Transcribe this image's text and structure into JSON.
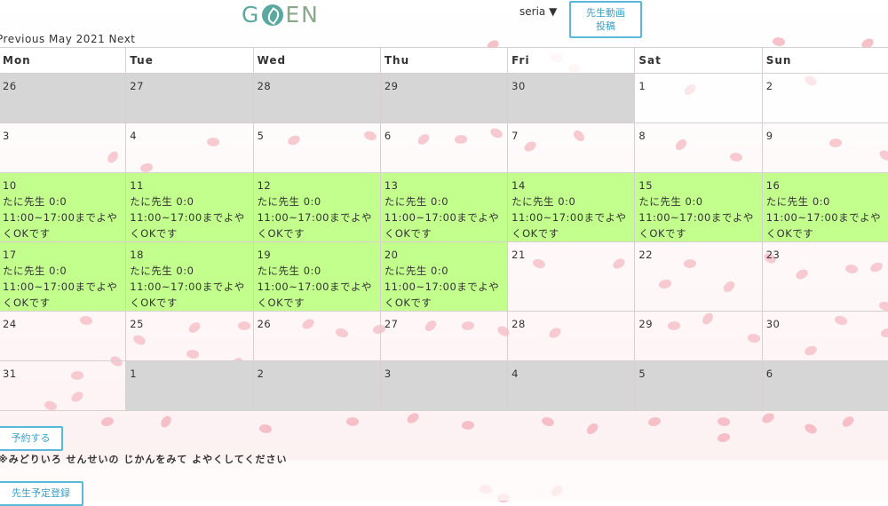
{
  "header": {
    "logo_text": "GOEN",
    "user_menu": "seria ▼",
    "upload_button": [
      "先生動画",
      "投稿"
    ]
  },
  "nav": {
    "previous": "Previous",
    "month_title": "May 2021",
    "next": "Next"
  },
  "weekdays": [
    "Mon",
    "Tue",
    "Wed",
    "Thu",
    "Fri",
    "Sat",
    "Sun"
  ],
  "weeks": [
    [
      {
        "day": "26",
        "state": "gray"
      },
      {
        "day": "27",
        "state": "gray"
      },
      {
        "day": "28",
        "state": "gray"
      },
      {
        "day": "29",
        "state": "gray"
      },
      {
        "day": "30",
        "state": "gray"
      },
      {
        "day": "1",
        "state": "plainw"
      },
      {
        "day": "2",
        "state": "plainw"
      }
    ],
    [
      {
        "day": "3",
        "state": "plain"
      },
      {
        "day": "4",
        "state": "plain"
      },
      {
        "day": "5",
        "state": "plain"
      },
      {
        "day": "6",
        "state": "plain"
      },
      {
        "day": "7",
        "state": "plain"
      },
      {
        "day": "8",
        "state": "plain"
      },
      {
        "day": "9",
        "state": "plain"
      }
    ],
    [
      {
        "day": "10",
        "state": "green",
        "teacher": "たに先生 0:0",
        "note": "11:00~17:00までよやくOKです"
      },
      {
        "day": "11",
        "state": "green",
        "teacher": "たに先生 0:0",
        "note": "11:00~17:00までよやくOKです"
      },
      {
        "day": "12",
        "state": "green",
        "teacher": "たに先生 0:0",
        "note": "11:00~17:00までよやくOKです"
      },
      {
        "day": "13",
        "state": "green",
        "teacher": "たに先生 0:0",
        "note": "11:00~17:00までよやくOKです"
      },
      {
        "day": "14",
        "state": "green",
        "teacher": "たに先生 0:0",
        "note": "11:00~17:00までよやくOKです"
      },
      {
        "day": "15",
        "state": "green",
        "teacher": "たに先生 0:0",
        "note": "11:00~17:00までよやくOKです"
      },
      {
        "day": "16",
        "state": "green",
        "teacher": "たに先生 0:0",
        "note": "11:00~17:00までよやくOKです"
      }
    ],
    [
      {
        "day": "17",
        "state": "green",
        "teacher": "たに先生 0:0",
        "note": "11:00~17:00までよやくOKです"
      },
      {
        "day": "18",
        "state": "green",
        "teacher": "たに先生 0:0",
        "note": "11:00~17:00までよやくOKです"
      },
      {
        "day": "19",
        "state": "green",
        "teacher": "たに先生 0:0",
        "note": "11:00~17:00までよやくOKです"
      },
      {
        "day": "20",
        "state": "green",
        "teacher": "たに先生 0:0",
        "note": "11:00~17:00までよやくOKです"
      },
      {
        "day": "21",
        "state": "plain"
      },
      {
        "day": "22",
        "state": "plain"
      },
      {
        "day": "23",
        "state": "plain"
      }
    ],
    [
      {
        "day": "24",
        "state": "plain"
      },
      {
        "day": "25",
        "state": "plain"
      },
      {
        "day": "26",
        "state": "plain"
      },
      {
        "day": "27",
        "state": "plain"
      },
      {
        "day": "28",
        "state": "plain"
      },
      {
        "day": "29",
        "state": "plain"
      },
      {
        "day": "30",
        "state": "plain"
      }
    ],
    [
      {
        "day": "31",
        "state": "plain"
      },
      {
        "day": "1",
        "state": "gray"
      },
      {
        "day": "2",
        "state": "gray"
      },
      {
        "day": "3",
        "state": "gray"
      },
      {
        "day": "4",
        "state": "gray"
      },
      {
        "day": "5",
        "state": "gray"
      },
      {
        "day": "6",
        "state": "gray"
      }
    ]
  ],
  "footer": {
    "reserve_button": "予約する",
    "note": "※みどりいろ せんせいの じかんをみて よやくしてください",
    "schedule_button": "先生予定登録"
  },
  "colors": {
    "available": "#c3ff8d",
    "outside_month": "#d6d6d6",
    "accent": "#5ab8d8",
    "petal": "#f4b6c0"
  }
}
